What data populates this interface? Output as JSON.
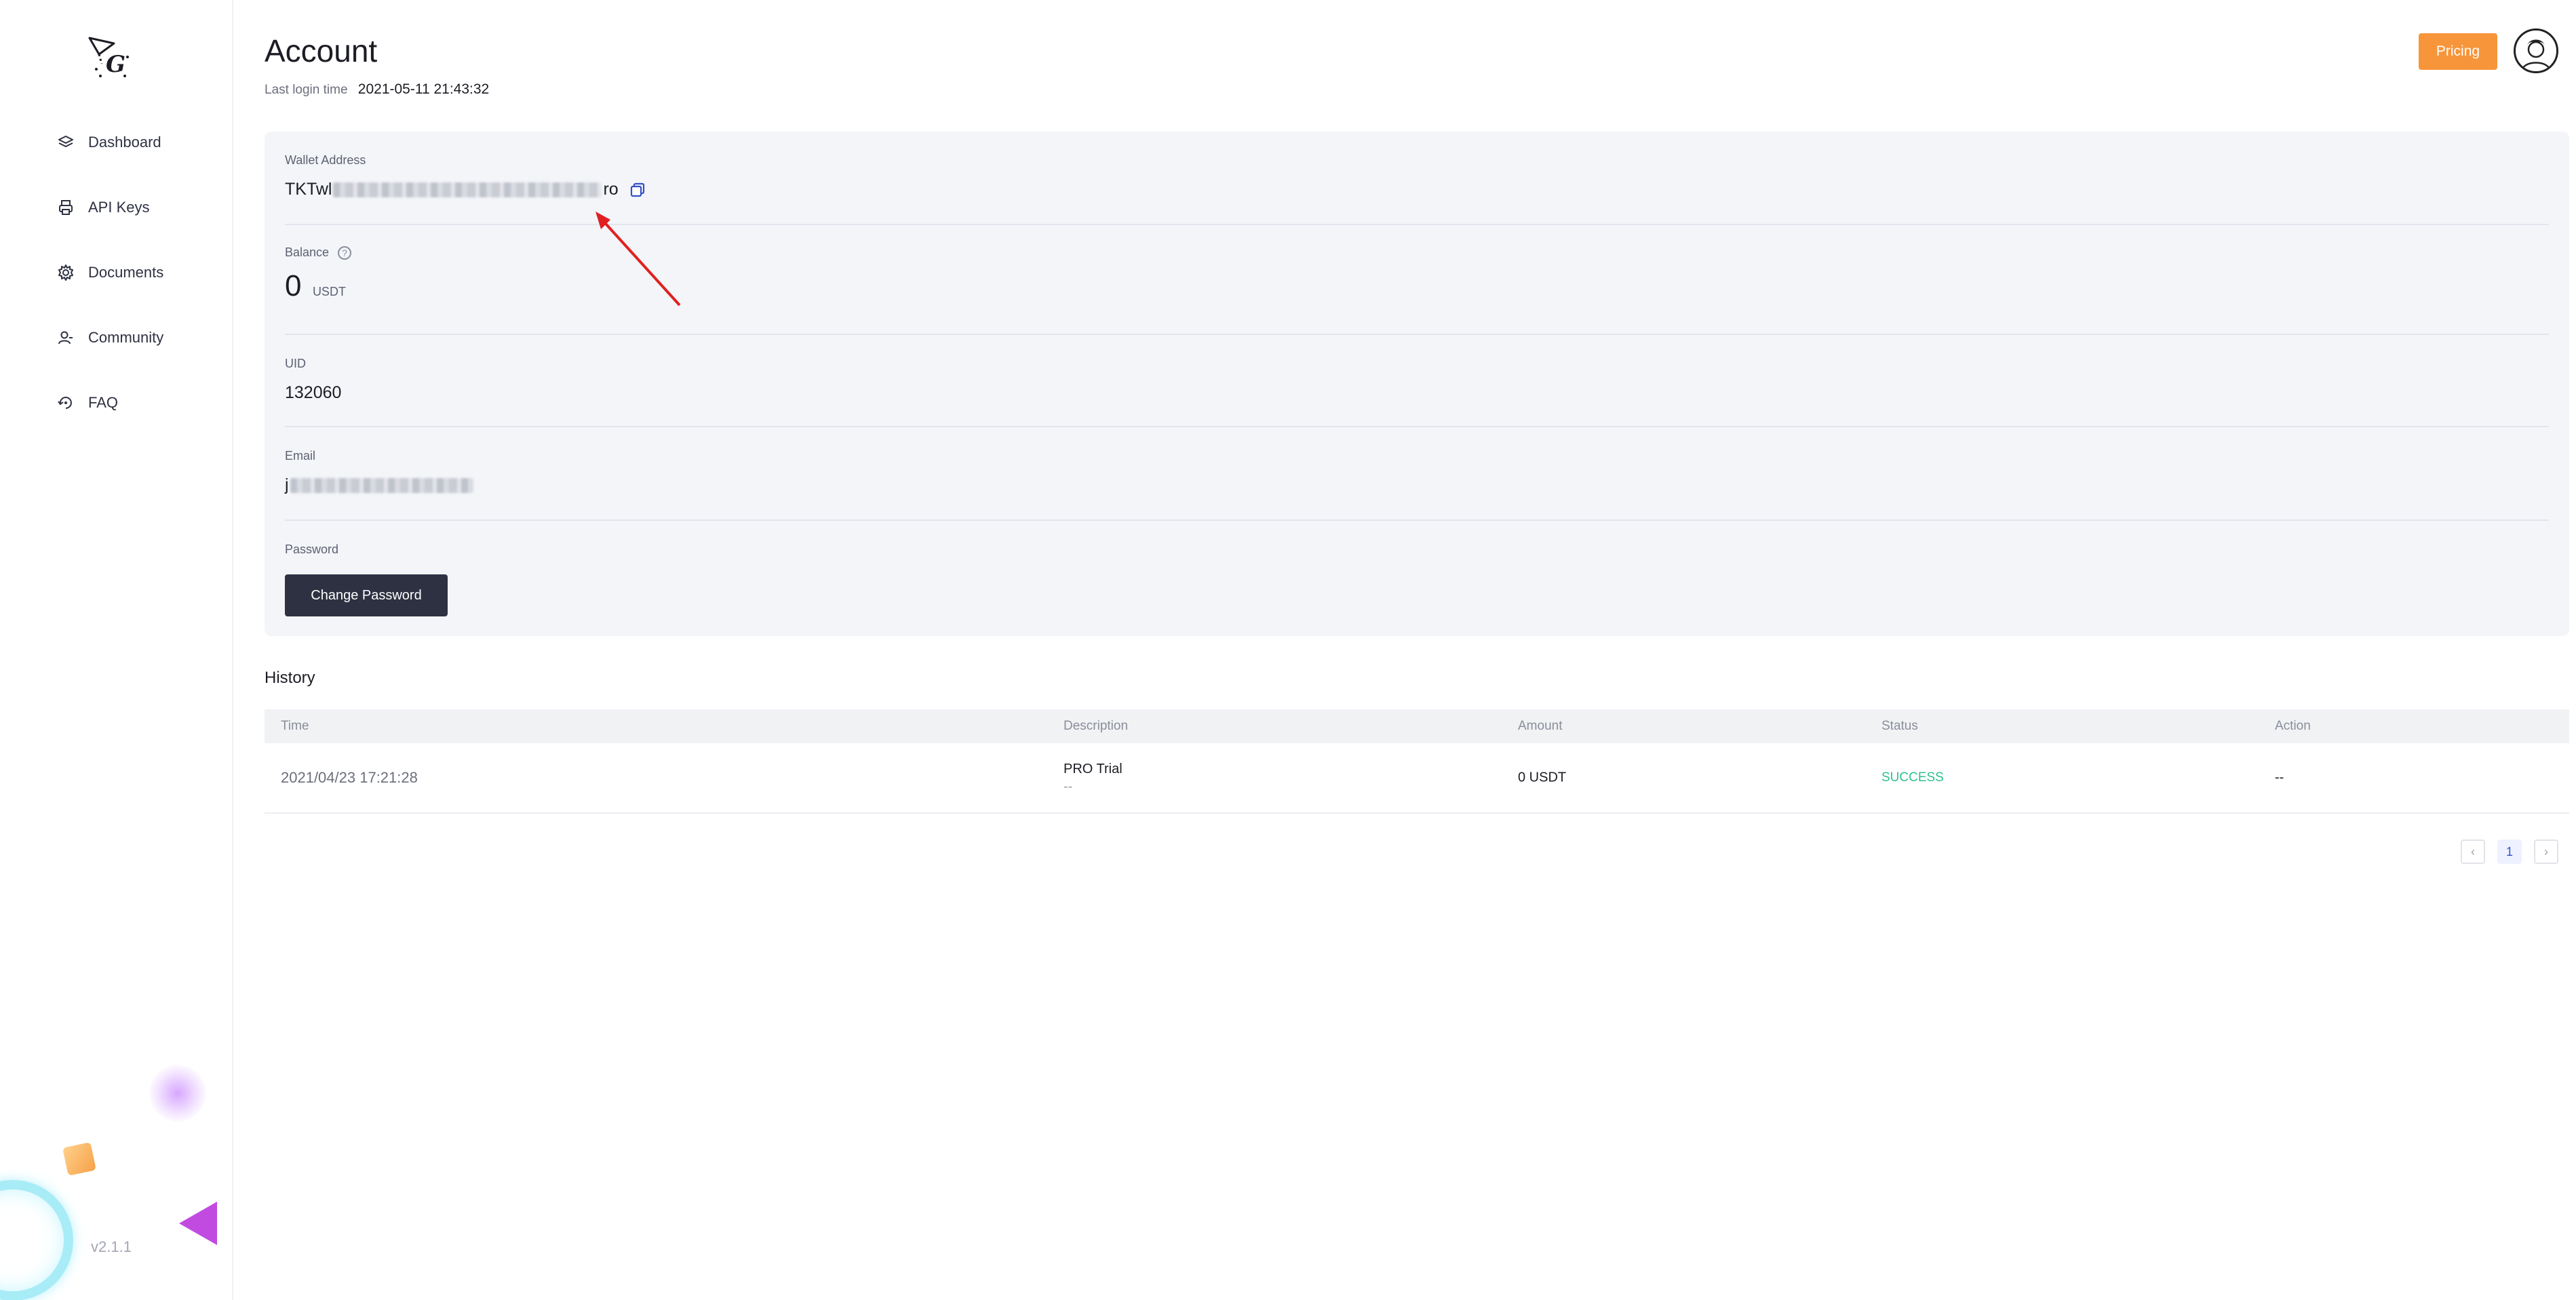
{
  "sidebar": {
    "logo_letter": "G",
    "items": [
      {
        "label": "Dashboard",
        "icon": "layers-icon"
      },
      {
        "label": "API Keys",
        "icon": "printer-icon"
      },
      {
        "label": "Documents",
        "icon": "gear-icon"
      },
      {
        "label": "Community",
        "icon": "user-group-icon"
      },
      {
        "label": "FAQ",
        "icon": "refresh-icon"
      }
    ],
    "version": "v2.1.1"
  },
  "header": {
    "title": "Account",
    "login_label": "Last login time",
    "login_value": "2021-05-11 21:43:32",
    "pricing_label": "Pricing"
  },
  "account": {
    "wallet_label": "Wallet Address",
    "wallet_prefix": "TKTwl",
    "wallet_suffix": "ro",
    "balance_label": "Balance",
    "balance_help": "?",
    "balance_value": "0",
    "balance_unit": "USDT",
    "uid_label": "UID",
    "uid_value": "132060",
    "email_label": "Email",
    "email_prefix": "j",
    "password_label": "Password",
    "change_password_label": "Change Password"
  },
  "history": {
    "title": "History",
    "columns": [
      "Time",
      "Description",
      "Amount",
      "Status",
      "Action"
    ],
    "rows": [
      {
        "time": "2021/04/23 17:21:28",
        "description": "PRO Trial",
        "description_sub": "--",
        "amount": "0 USDT",
        "status": "SUCCESS",
        "action": "--"
      }
    ]
  },
  "pagination": {
    "prev": "‹",
    "current": "1",
    "next": "›"
  },
  "colors": {
    "accent_orange": "#f7953a",
    "success_green": "#2fc08e",
    "dark_button": "#2e3142",
    "annotation_red": "#e02020"
  }
}
